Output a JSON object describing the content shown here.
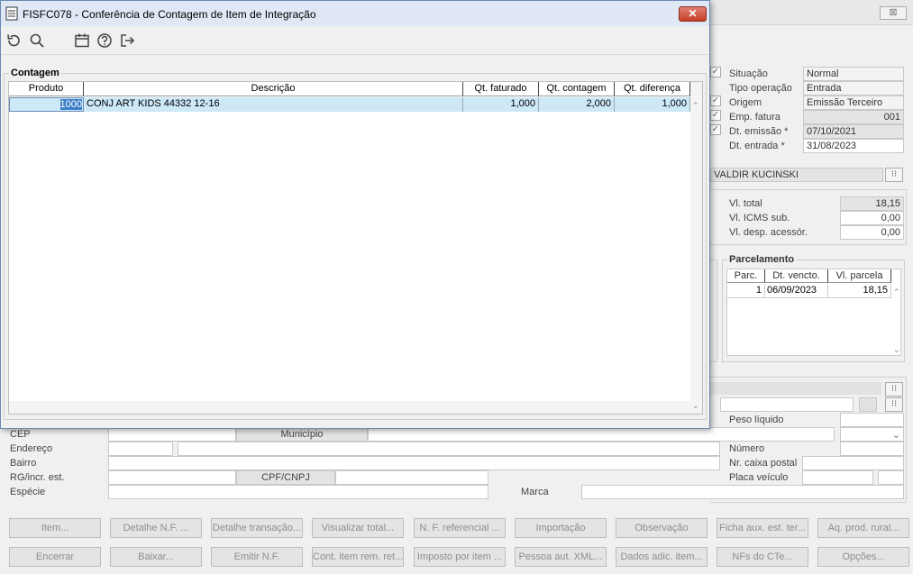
{
  "background": {
    "close_glyph": "⊠",
    "fields_top": [
      {
        "label": "Situação",
        "value": "Normal"
      },
      {
        "label": "Tipo operação",
        "value": "Entrada"
      },
      {
        "label": "Origem",
        "value": "Emissão Terceiro"
      },
      {
        "label": "Emp. fatura",
        "value": "001"
      },
      {
        "label": "Dt. emissão *",
        "value": "07/10/2021"
      },
      {
        "label": "Dt. entrada *",
        "value": "31/08/2023"
      }
    ],
    "person_name": "VALDIR KUCINSKI",
    "totals": [
      {
        "label": "Vl. total",
        "value": "18,15"
      },
      {
        "label": "Vl. ICMS sub.",
        "value": "0,00"
      },
      {
        "label": "Vl. desp. acessór.",
        "value": "0,00"
      }
    ],
    "parcelamento": {
      "title": "Parcelamento",
      "headers": [
        "Parc.",
        "Dt. vencto.",
        "Vl. parcela"
      ],
      "rows": [
        {
          "parc": "1",
          "vencto": "06/09/2023",
          "valor": "18,15"
        }
      ]
    },
    "address": {
      "cep_label": "CEP",
      "municipio_label": "Município",
      "endereco_label": "Endereço",
      "bairro_label": "Bairro",
      "rg_label": "RG/incr. est.",
      "cpf_label": "CPF/CNPJ",
      "especie_label": "Espécie",
      "marca_label": "Marca",
      "peso_label": "Peso líquido",
      "numero_label": "Número",
      "caixa_label": "Nr. caixa postal",
      "placa_label": "Placa veículo"
    },
    "buttons_row1": [
      "Item...",
      "Detalhe N.F. ...",
      "Detalhe transação...",
      "Visualizar total...",
      "N. F. referencial ...",
      "Importação",
      "Observação",
      "Ficha aux. est. ter...",
      "Aq. prod. rural..."
    ],
    "buttons_row2": [
      "Encerrar",
      "Baixar...",
      "Emitir N.F.",
      "Cont. item rem. ret...",
      "Imposto por item ...",
      "Pessoa aut. XML...",
      "Dados adic. item...",
      "NFs do CTe...",
      "Opções..."
    ]
  },
  "dialog": {
    "title": "FISFC078 - Conferência de Contagem de Item de Integração",
    "close_glyph": "✕",
    "toolbar": [
      "refresh-icon",
      "search-icon",
      "calendar-icon",
      "help-icon",
      "exit-icon"
    ],
    "group_title": "Contagem",
    "grid": {
      "headers": [
        "Produto",
        "Descrição",
        "Qt. faturado",
        "Qt. contagem",
        "Qt. diferença"
      ],
      "rows": [
        {
          "produto": "1000",
          "descricao": "CONJ ART KIDS 44332 12-16",
          "faturado": "1,000",
          "contagem": "2,000",
          "diferenca": "1,000"
        }
      ]
    }
  }
}
